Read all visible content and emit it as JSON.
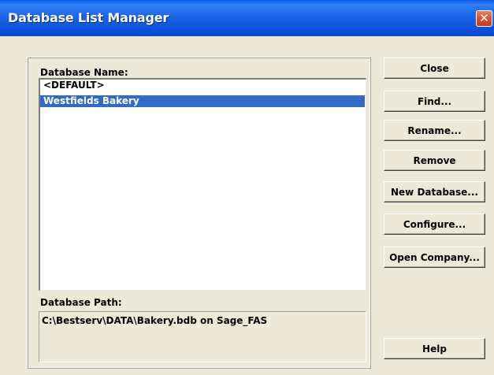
{
  "window": {
    "title": "Database List Manager"
  },
  "titlebar": {
    "close_glyph": "✕"
  },
  "database_name_label": "Database Name:",
  "databases": [
    {
      "name": "<DEFAULT>",
      "selected": false
    },
    {
      "name": "Westfields Bakery",
      "selected": true
    }
  ],
  "database_path_label": "Database Path:",
  "database_path_value": "C:\\Bestserv\\DATA\\Bakery.bdb on Sage_FAS",
  "buttons": {
    "close": "Close",
    "find": "Find...",
    "rename": "Rename...",
    "remove": "Remove",
    "new_database": "New Database...",
    "configure": "Configure...",
    "open_company": "Open Company...",
    "help": "Help"
  },
  "colors": {
    "selection": "#316ac5",
    "titlebar": "#0b4fd8",
    "dialog_bg": "#ece9d8"
  }
}
